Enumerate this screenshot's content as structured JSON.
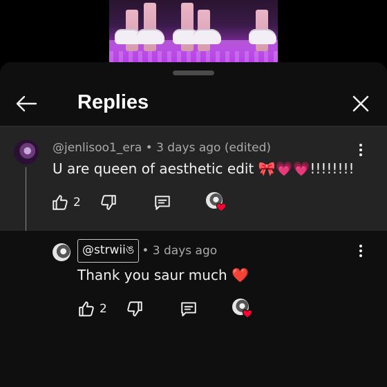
{
  "sheet": {
    "title": "Replies",
    "back_icon": "arrow-left-icon",
    "close_icon": "close-icon"
  },
  "parent_comment": {
    "meta": "@jenlisoo1_era • 3 days ago (edited)",
    "text": "U are queen of aesthetic edit 🎀💗💗!!!!!!!!",
    "like_count": "2"
  },
  "reply_comment": {
    "mention": "@strwiiঙ",
    "meta": "• 3 days ago",
    "text": "Thank you saur much ❤️",
    "like_count": "2"
  },
  "colors": {
    "sheet_bg": "#0f0f0f",
    "highlight_bg": "#242424",
    "heart": "#ff0033",
    "secondary_text": "#aaaaaa"
  }
}
